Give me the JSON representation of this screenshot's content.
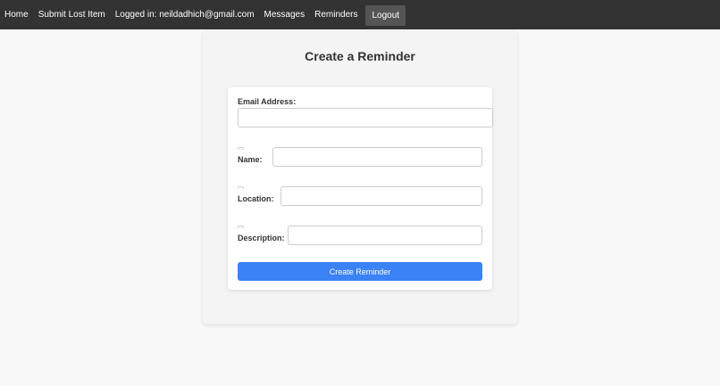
{
  "nav": {
    "home": "Home",
    "submit_lost_item": "Submit Lost Item",
    "logged_in": "Logged in: neildadhich@gmail.com",
    "messages": "Messages",
    "reminders": "Reminders",
    "logout": "Logout"
  },
  "form": {
    "title": "Create a Reminder",
    "email_label": "Email Address:",
    "email_value": "",
    "name_label": "Name:",
    "name_value": "",
    "location_label": "Location:",
    "location_value": "",
    "description_label": "Description:",
    "description_value": "",
    "submit_label": "Create Reminder"
  },
  "colors": {
    "navbar": "#333333",
    "logout_bg": "#555555",
    "primary_button": "#3b82f6",
    "page_bg": "#f8f8f8"
  }
}
